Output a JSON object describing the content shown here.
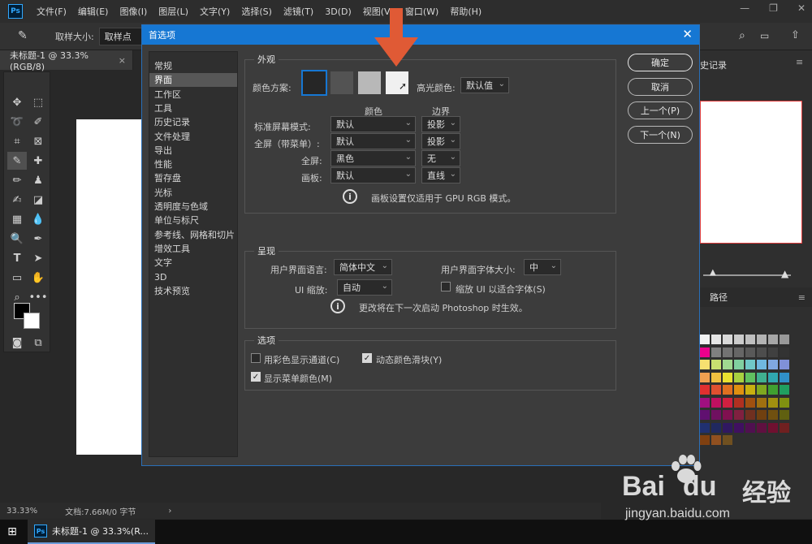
{
  "menubar": {
    "logo": "Ps",
    "items": [
      "文件(F)",
      "编辑(E)",
      "图像(I)",
      "图层(L)",
      "文字(Y)",
      "选择(S)",
      "滤镜(T)",
      "3D(D)",
      "视图(V)",
      "窗口(W)",
      "帮助(H)"
    ],
    "controls": [
      "—",
      "❐",
      "✕"
    ]
  },
  "optionsbar": {
    "sample_label": "取样大小:",
    "sample_value": "取样点"
  },
  "doc_tab": {
    "title": "未标题-1 @ 33.3%(RGB/8)",
    "modified": "®",
    "close": "×"
  },
  "status": {
    "zoom": "33.33%",
    "doc_info": "文档:7.66M/0 字节"
  },
  "right_panel": {
    "history_tab": "史记录",
    "paths_tab": "路径"
  },
  "taskbar": {
    "item": "未标题-1 @ 33.3%(R..."
  },
  "dialog": {
    "title": "首选项",
    "close": "✕",
    "nav": [
      "常规",
      "界面",
      "工作区",
      "工具",
      "历史记录",
      "文件处理",
      "导出",
      "性能",
      "暂存盘",
      "光标",
      "透明度与色域",
      "单位与标尺",
      "参考线、网格和切片",
      "增效工具",
      "文字",
      "3D",
      "技术预览"
    ],
    "active_nav": 1,
    "buttons": {
      "ok": "确定",
      "cancel": "取消",
      "prev": "上一个(P)",
      "next": "下一个(N)"
    },
    "appearance": {
      "title": "外观",
      "color_scheme_label": "颜色方案:",
      "schemes": [
        "#262626",
        "#535353",
        "#b8b8b8",
        "#f0f0f0"
      ],
      "selected_scheme": 0,
      "highlight_label": "高光颜色:",
      "highlight_value": "默认值",
      "col_color": "颜色",
      "col_border": "边界",
      "rows": [
        {
          "label": "标准屏幕模式:",
          "color": "默认",
          "border": "投影"
        },
        {
          "label": "全屏（带菜单）:",
          "color": "默认",
          "border": "投影"
        },
        {
          "label": "全屏:",
          "color": "黑色",
          "border": "无"
        },
        {
          "label": "画板:",
          "color": "默认",
          "border": "直线"
        }
      ],
      "note": "画板设置仅适用于 GPU RGB 模式。"
    },
    "presentation": {
      "title": "呈现",
      "ui_lang_label": "用户界面语言:",
      "ui_lang_value": "简体中文",
      "ui_font_label": "用户界面字体大小:",
      "ui_font_value": "中",
      "ui_scale_label": "UI 缩放:",
      "ui_scale_value": "自动",
      "scale_checkbox": "缩放 UI 以适合字体(S)",
      "note": "更改将在下一次启动 Photoshop 时生效。"
    },
    "options": {
      "title": "选项",
      "chk1": "用彩色显示通道(C)",
      "chk2": "动态颜色滑块(Y)",
      "chk3": "显示菜单颜色(M)"
    }
  },
  "watermark": {
    "brand": "Bai",
    "brand2": "du",
    "brand_cn": "经验",
    "url": "jingyan.baidu.com"
  },
  "colors": {
    "accent": "#1677d3",
    "arrow": "#e05a35",
    "panel": "#3c3c3c"
  },
  "swatches": [
    "#f2f2f2",
    "#e6e6e6",
    "#d9d9d9",
    "#cccccc",
    "#bfbfbf",
    "#b3b3b3",
    "#a6a6a6",
    "#999999",
    "#ec008c",
    "#808080",
    "#737373",
    "#666666",
    "#595959",
    "#4d4d4d",
    "#404040",
    "#333333",
    "#f7e070",
    "#c8e070",
    "#a0d890",
    "#80d0a0",
    "#70c8c8",
    "#70b8e0",
    "#80a8e0",
    "#8090d8",
    "#f0a050",
    "#f0c040",
    "#e8e030",
    "#a8d040",
    "#60c060",
    "#40b090",
    "#30a8b0",
    "#3090c8",
    "#e03030",
    "#e05030",
    "#e07020",
    "#e09010",
    "#c8b010",
    "#80a820",
    "#40a030",
    "#20a060",
    "#a01080",
    "#c01060",
    "#d02040",
    "#b03020",
    "#a05010",
    "#a07010",
    "#a09010",
    "#809010",
    "#601070",
    "#701060",
    "#801050",
    "#802040",
    "#703020",
    "#704010",
    "#705010",
    "#606010",
    "#203070",
    "#202860",
    "#301860",
    "#401060",
    "#501050",
    "#601040",
    "#701030",
    "#702020",
    "#804010",
    "#905020",
    "#705020"
  ]
}
